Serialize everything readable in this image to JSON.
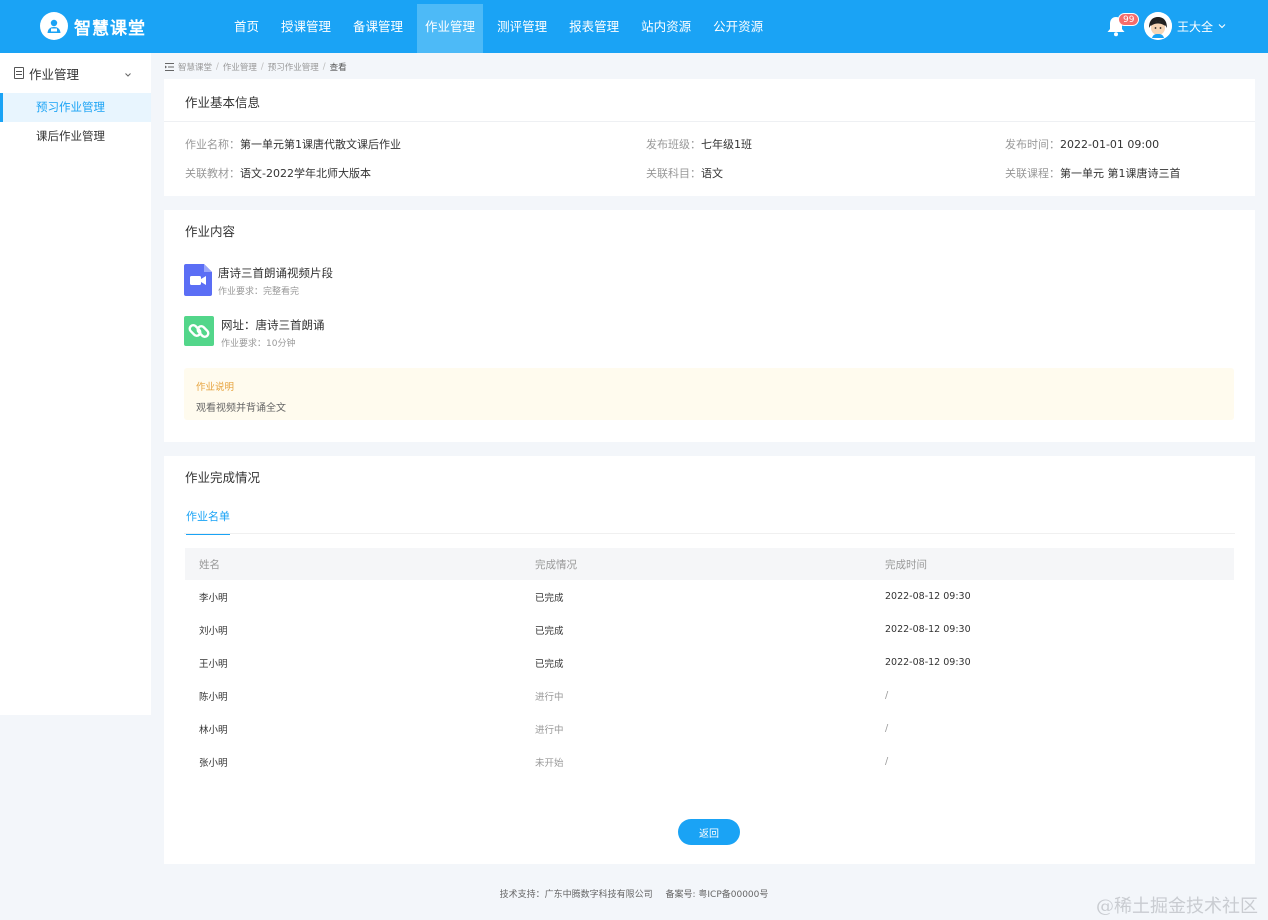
{
  "header": {
    "logo_text": "智慧课堂",
    "nav": [
      "首页",
      "授课管理",
      "备课管理",
      "作业管理",
      "测评管理",
      "报表管理",
      "站内资源",
      "公开资源"
    ],
    "active_nav": "作业管理",
    "notification_count": "99",
    "user_name": "王大全",
    "icons": [
      "logo-icon",
      "bell-icon",
      "avatar-icon",
      "chevron-down-icon"
    ],
    "accent_color": "#1aa3f5"
  },
  "sidebar": {
    "group_label": "作业管理",
    "items": [
      {
        "label": "预习作业管理",
        "active": true
      },
      {
        "label": "课后作业管理",
        "active": false
      }
    ]
  },
  "breadcrumb": [
    "智慧课堂",
    "作业管理",
    "预习作业管理",
    "查看"
  ],
  "basic_info": {
    "title": "作业基本信息",
    "fields": [
      {
        "key": "作业名称：",
        "value": "第一单元第1课唐代散文课后作业"
      },
      {
        "key": "发布班级：",
        "value": "七年级1班"
      },
      {
        "key": "发布时间：",
        "value": "2022-01-01  09:00"
      },
      {
        "key": "关联教材：",
        "value": "语文-2022学年北师大版本"
      },
      {
        "key": "关联科目：",
        "value": "语文"
      },
      {
        "key": "关联课程：",
        "value": "第一单元 第1课唐诗三首"
      }
    ]
  },
  "content": {
    "title": "作业内容",
    "resources": [
      {
        "icon": "video-file-icon",
        "title": "唐诗三首朗诵视频片段",
        "requirement": "作业要求：完整看完"
      },
      {
        "icon": "link-icon",
        "title": "网址：唐诗三首朗诵",
        "requirement": "作业要求：10分钟"
      }
    ],
    "note_label": "作业说明",
    "note_text": "观看视频并背诵全文"
  },
  "completion": {
    "title": "作业完成情况",
    "tab": "作业名单",
    "columns": [
      "姓名",
      "完成情况",
      "完成时间"
    ],
    "rows": [
      {
        "name": "李小明",
        "status": "已完成",
        "time": "2022-08-12 09:30"
      },
      {
        "name": "刘小明",
        "status": "已完成",
        "time": "2022-08-12 09:30"
      },
      {
        "name": "王小明",
        "status": "已完成",
        "time": "2022-08-12 09:30"
      },
      {
        "name": "陈小明",
        "status": "进行中",
        "time": "/"
      },
      {
        "name": "林小明",
        "status": "进行中",
        "time": "/"
      },
      {
        "name": "张小明",
        "status": "未开始",
        "time": "/"
      }
    ],
    "back_button": "返回"
  },
  "footer": {
    "support": "技术支持：广东中腾数字科技有限公司",
    "icp": "备案号: 粤ICP备00000号"
  },
  "watermark": "@稀土掘金技术社区"
}
